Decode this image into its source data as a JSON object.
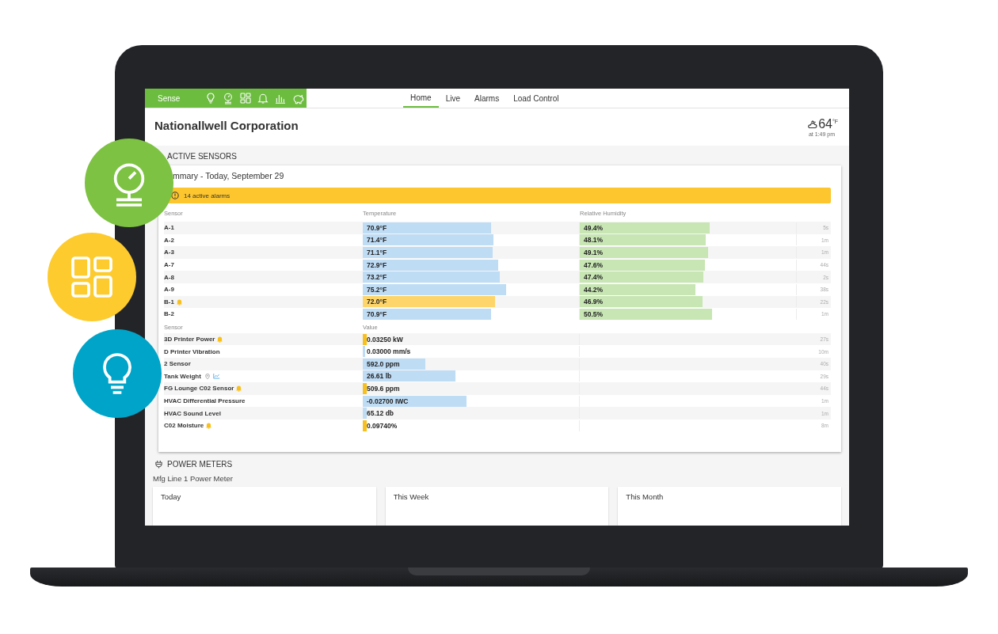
{
  "app_bar": {
    "brand": "Sense",
    "icons": [
      {
        "kind": "bulb"
      },
      {
        "kind": "gauge"
      },
      {
        "kind": "tiles"
      },
      {
        "kind": "bell"
      },
      {
        "kind": "bars"
      },
      {
        "kind": "piggy"
      }
    ]
  },
  "tabs": [
    {
      "label": "Home",
      "selected": true
    },
    {
      "label": "Live",
      "selected": false
    },
    {
      "label": "Alarms",
      "selected": false
    },
    {
      "label": "Load Control",
      "selected": false
    }
  ],
  "header": {
    "title": "Nationallwell Corporation",
    "weather": {
      "temperature": "64",
      "unit": "°F",
      "time": "at 1:49 pm"
    }
  },
  "active_sensors": {
    "heading": "ACTIVE SENSORS",
    "summary_title": "mmary - Today, September 29",
    "alarm_banner": "14 active alarms",
    "climate_columns": [
      "Sensor",
      "Temperature",
      "Relative Humidity"
    ],
    "climate_rows": [
      {
        "sensor": "A-1",
        "alarm": false,
        "temperature": {
          "text": "70.9°F",
          "level": 0.595
        },
        "humidity": {
          "text": "49.4%",
          "level": 0.6
        },
        "age": "5s"
      },
      {
        "sensor": "A-2",
        "alarm": false,
        "temperature": {
          "text": "71.4°F",
          "level": 0.606
        },
        "humidity": {
          "text": "48.1%",
          "level": 0.584
        },
        "age": "1m"
      },
      {
        "sensor": "A-3",
        "alarm": false,
        "temperature": {
          "text": "71.1°F",
          "level": 0.6
        },
        "humidity": {
          "text": "49.1%",
          "level": 0.595
        },
        "age": "1m"
      },
      {
        "sensor": "A-7",
        "alarm": false,
        "temperature": {
          "text": "72.9°F",
          "level": 0.628
        },
        "humidity": {
          "text": "47.6%",
          "level": 0.577
        },
        "age": "44s"
      },
      {
        "sensor": "A-8",
        "alarm": false,
        "temperature": {
          "text": "73.2°F",
          "level": 0.635
        },
        "humidity": {
          "text": "47.4%",
          "level": 0.573
        },
        "age": "2s"
      },
      {
        "sensor": "A-9",
        "alarm": false,
        "temperature": {
          "text": "75.2°F",
          "level": 0.664
        },
        "humidity": {
          "text": "44.2%",
          "level": 0.536
        },
        "age": "38s"
      },
      {
        "sensor": "B-1",
        "alarm": true,
        "temperature": {
          "text": "72.0°F",
          "level": 0.613
        },
        "humidity": {
          "text": "46.9%",
          "level": 0.569
        },
        "age": "22s"
      },
      {
        "sensor": "B-2",
        "alarm": false,
        "temperature": {
          "text": "70.9°F",
          "level": 0.595
        },
        "humidity": {
          "text": "50.5%",
          "level": 0.613
        },
        "age": "1m"
      }
    ],
    "value_columns": [
      "Sensor",
      "Value"
    ],
    "value_rows": [
      {
        "sensor": "3D Printer Power",
        "alarm": true,
        "location": false,
        "trend": false,
        "value": "0.03250 kW",
        "level": 0.02,
        "age": "27s"
      },
      {
        "sensor": "D Printer Vibration",
        "alarm": false,
        "location": false,
        "trend": false,
        "value": "0.03000 mm/s",
        "level": 0.01,
        "age": "10m"
      },
      {
        "sensor": "2 Sensor",
        "alarm": false,
        "location": false,
        "trend": false,
        "value": "592.0 ppm",
        "level": 0.29,
        "age": "40s"
      },
      {
        "sensor": "Tank Weight",
        "alarm": false,
        "location": true,
        "trend": true,
        "value": "26.61 lb",
        "level": 0.43,
        "age": "29s"
      },
      {
        "sensor": "FG Lounge C02 Sensor",
        "alarm": true,
        "location": false,
        "trend": false,
        "value": "509.6 ppm",
        "level": 0.02,
        "age": "44s"
      },
      {
        "sensor": "HVAC Differential Pressure",
        "alarm": false,
        "location": false,
        "trend": false,
        "value": "-0.02700 IWC",
        "level": 0.48,
        "age": "1m"
      },
      {
        "sensor": "HVAC Sound Level",
        "alarm": false,
        "location": false,
        "trend": false,
        "value": "65.12 db",
        "level": 0.02,
        "age": "1m"
      },
      {
        "sensor": "C02 Moisture",
        "alarm": true,
        "location": false,
        "trend": false,
        "value": "0.09740%",
        "level": 0.02,
        "age": "8m"
      }
    ]
  },
  "power_meters": {
    "heading": "POWER METERS",
    "meter_name": "Mfg Line 1 Power Meter",
    "periods": [
      "Today",
      "This Week",
      "This Month"
    ]
  },
  "feature_circles": [
    {
      "kind": "gauge",
      "color": "#7dc242"
    },
    {
      "kind": "tiles",
      "color": "#fdcb2e"
    },
    {
      "kind": "bulb",
      "color": "#00a4c8"
    }
  ]
}
